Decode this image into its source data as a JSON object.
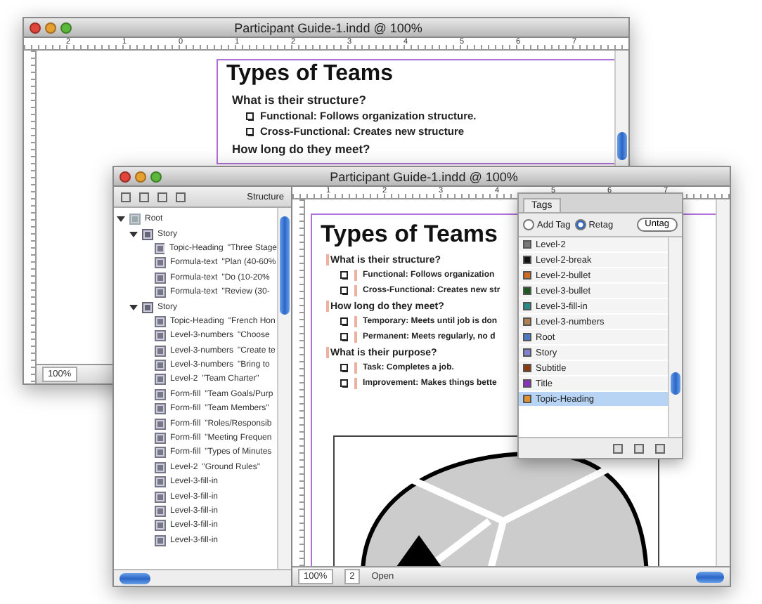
{
  "back_window": {
    "title": "Participant Guide-1.indd @ 100%",
    "ruler_labels": [
      "2",
      "1",
      "0",
      "1",
      "2",
      "3",
      "4",
      "5",
      "6",
      "7"
    ],
    "document": {
      "title": "Types of Teams",
      "sections": [
        {
          "heading": "What is their structure?",
          "bullets": [
            "Functional: Follows organization structure.",
            "Cross-Functional: Creates new structure"
          ]
        },
        {
          "heading": "How long do they meet?"
        }
      ]
    },
    "zoom": "100%"
  },
  "front_window": {
    "title": "Participant Guide-1.indd @ 100%",
    "structure_panel": {
      "title": "Structure",
      "tree": [
        {
          "kind": "root",
          "element": "Root",
          "expanded": true,
          "children": [
            {
              "kind": "story",
              "element": "Story",
              "expanded": true,
              "children": [
                {
                  "kind": "element",
                  "element": "Topic-Heading",
                  "content": "\"Three Stage"
                },
                {
                  "kind": "element",
                  "element": "Formula-text",
                  "content": "\"Plan (40-60%"
                },
                {
                  "kind": "element",
                  "element": "Formula-text",
                  "content": "\"Do (10-20%"
                },
                {
                  "kind": "element",
                  "element": "Formula-text",
                  "content": "\"Review (30-"
                }
              ]
            },
            {
              "kind": "story",
              "element": "Story",
              "expanded": true,
              "children": [
                {
                  "kind": "element",
                  "element": "Topic-Heading",
                  "content": "\"French Hon"
                },
                {
                  "kind": "element",
                  "element": "Level-3-numbers",
                  "content": "\"Choose"
                },
                {
                  "kind": "element",
                  "element": "Level-3-numbers",
                  "content": "\"Create te"
                },
                {
                  "kind": "element",
                  "element": "Level-3-numbers",
                  "content": "\"Bring to"
                },
                {
                  "kind": "element",
                  "element": "Level-2",
                  "content": "\"Team Charter\""
                },
                {
                  "kind": "element",
                  "element": "Form-fill",
                  "content": "\"Team Goals/Purp"
                },
                {
                  "kind": "element",
                  "element": "Form-fill",
                  "content": "\"Team Members\""
                },
                {
                  "kind": "element",
                  "element": "Form-fill",
                  "content": "\"Roles/Responsib"
                },
                {
                  "kind": "element",
                  "element": "Form-fill",
                  "content": "\"Meeting Frequen"
                },
                {
                  "kind": "element",
                  "element": "Form-fill",
                  "content": "\"Types of Minutes"
                },
                {
                  "kind": "element",
                  "element": "Level-2",
                  "content": "\"Ground Rules\""
                },
                {
                  "kind": "element",
                  "element": "Level-3-fill-in"
                },
                {
                  "kind": "element",
                  "element": "Level-3-fill-in"
                },
                {
                  "kind": "element",
                  "element": "Level-3-fill-in"
                },
                {
                  "kind": "element",
                  "element": "Level-3-fill-in"
                },
                {
                  "kind": "element",
                  "element": "Level-3-fill-in"
                }
              ]
            }
          ]
        }
      ]
    },
    "ruler_labels": [
      "1",
      "2",
      "3",
      "4",
      "5",
      "6",
      "7"
    ],
    "document": {
      "title": "Types of Teams",
      "sections": [
        {
          "heading": "What is their structure?",
          "bullets": [
            "Functional: Follows organization",
            "Cross-Functional: Creates new str"
          ]
        },
        {
          "heading": "How long do they meet?",
          "bullets": [
            "Temporary: Meets until job is don",
            "Permanent: Meets regularly, no d"
          ]
        },
        {
          "heading": "What is their purpose?",
          "bullets": [
            "Task: Completes a job.",
            "Improvement: Makes things bette"
          ]
        }
      ]
    },
    "status_bar": {
      "zoom": "100%",
      "page": "2",
      "status": "Open"
    }
  },
  "tags_panel": {
    "tab": "Tags",
    "modes": [
      {
        "label": "Add Tag",
        "selected": false
      },
      {
        "label": "Retag",
        "selected": true
      }
    ],
    "untag_button": "Untag",
    "tags": [
      {
        "name": "Level-2",
        "color": "#777777",
        "selected": false
      },
      {
        "name": "Level-2-break",
        "color": "#111111",
        "selected": false
      },
      {
        "name": "Level-2-bullet",
        "color": "#d06a20",
        "selected": false
      },
      {
        "name": "Level-3-bullet",
        "color": "#1e5a1e",
        "selected": false
      },
      {
        "name": "Level-3-fill-in",
        "color": "#2a8a8a",
        "selected": false
      },
      {
        "name": "Level-3-numbers",
        "color": "#b08050",
        "selected": false
      },
      {
        "name": "Root",
        "color": "#4a7ac8",
        "selected": false
      },
      {
        "name": "Story",
        "color": "#8080d0",
        "selected": false
      },
      {
        "name": "Subtitle",
        "color": "#8a3a10",
        "selected": false
      },
      {
        "name": "Title",
        "color": "#8a30c0",
        "selected": false
      },
      {
        "name": "Topic-Heading",
        "color": "#e09030",
        "selected": true
      }
    ]
  }
}
